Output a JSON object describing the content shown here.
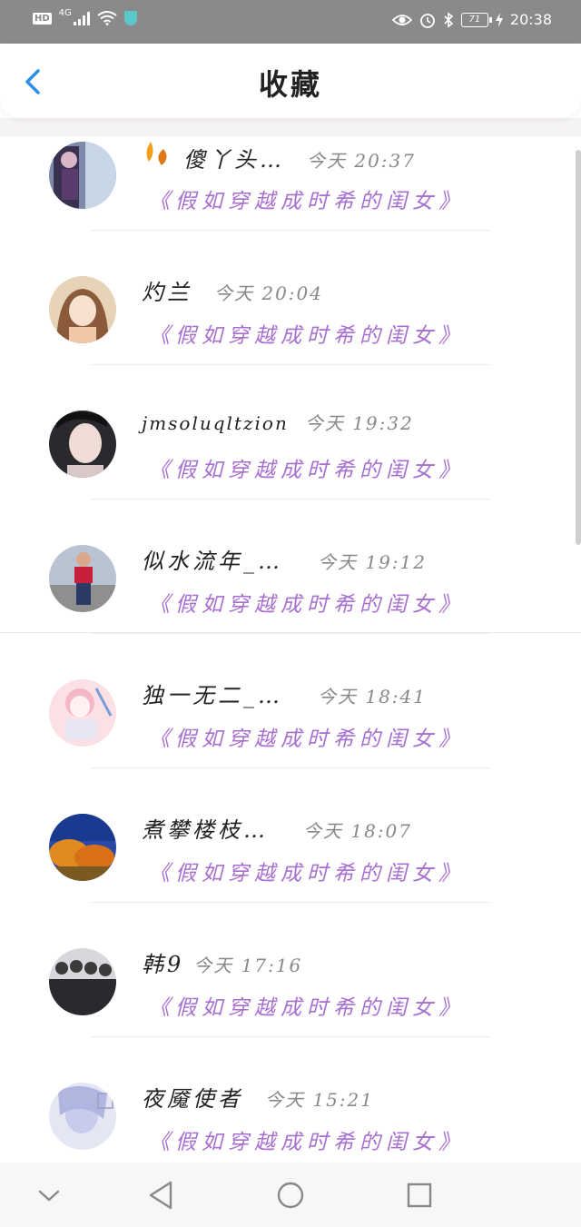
{
  "status_bar": {
    "hd": "HD",
    "network": "4G",
    "battery": "71",
    "time": "20:38",
    "icons": [
      "signal-icon",
      "wifi-icon",
      "shield-icon",
      "eye-icon",
      "alarm-icon",
      "bluetooth-icon",
      "battery-icon",
      "charging-icon"
    ]
  },
  "header": {
    "title": "收藏",
    "back_icon": "chevron-left-icon",
    "accent": "#2f8fe8"
  },
  "colors": {
    "book_title": "#a66fd0",
    "name": "#222222",
    "time": "#888888"
  },
  "items": [
    {
      "name": "傻丫头…",
      "time": "今天 20:37",
      "book": "《假如穿越成时希的闺女》",
      "badge": "leaf-icon"
    },
    {
      "name": "灼兰",
      "time": "今天 20:04",
      "book": "《假如穿越成时希的闺女》"
    },
    {
      "name": "jmsoluqltzion",
      "time": "今天 19:32",
      "book": "《假如穿越成时希的闺女》"
    },
    {
      "name": "似水流年_…",
      "time": "今天 19:12",
      "book": "《假如穿越成时希的闺女》"
    },
    {
      "name": "独一无二_…",
      "time": "今天 18:41",
      "book": "《假如穿越成时希的闺女》"
    },
    {
      "name": "煮攀楼枝…",
      "time": "今天 18:07",
      "book": "《假如穿越成时希的闺女》"
    },
    {
      "name": "韩9",
      "time": "今天 17:16",
      "book": "《假如穿越成时希的闺女》"
    },
    {
      "name": "夜魇使者",
      "time": "今天 15:21",
      "book": "《假如穿越成时希的闺女》"
    }
  ],
  "nav_bar": {
    "icons": [
      "collapse-down-icon",
      "back-triangle-icon",
      "home-circle-icon",
      "recents-square-icon"
    ]
  }
}
